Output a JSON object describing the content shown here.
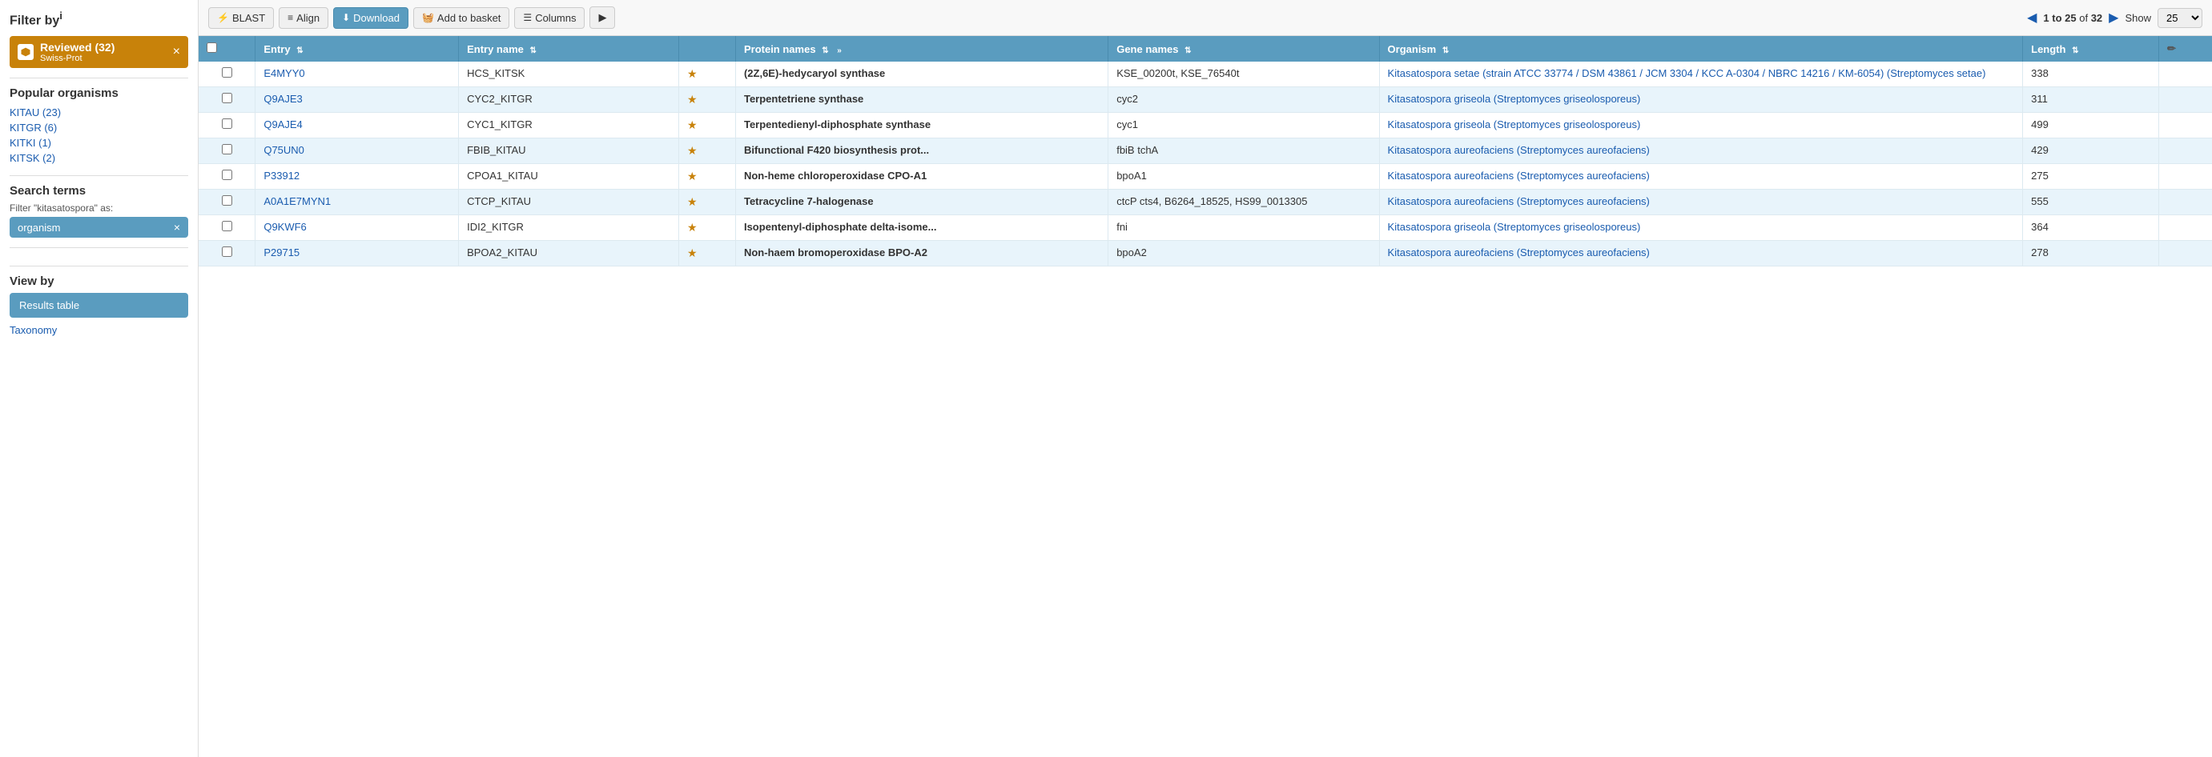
{
  "sidebar": {
    "filter_title": "Filter by",
    "filter_title_sup": "i",
    "reviewed_badge": {
      "label": "Reviewed (32)",
      "sublabel": "Swiss-Prot",
      "close": "×"
    },
    "popular_organisms_title": "Popular organisms",
    "organisms": [
      {
        "label": "KITAU (23)"
      },
      {
        "label": "KITGR (6)"
      },
      {
        "label": "KITKI (1)"
      },
      {
        "label": "KITSK (2)"
      }
    ],
    "search_terms_title": "Search terms",
    "filter_as_label": "Filter \"kitasatospora\" as:",
    "filter_tag": {
      "text": "organism",
      "close": "×"
    },
    "view_by_title": "View by",
    "results_table_btn": "Results table",
    "taxonomy_link": "Taxonomy"
  },
  "toolbar": {
    "blast_btn": "BLAST",
    "align_btn": "Align",
    "download_btn": "Download",
    "basket_btn": "Add to basket",
    "columns_btn": "Columns",
    "forward_btn": "▶",
    "pagination": {
      "prefix": "",
      "range": "1 to 25",
      "of": "of",
      "total": "32",
      "show_label": "Show",
      "show_value": "25"
    },
    "prev_icon": "◀",
    "next_icon": "▶"
  },
  "table": {
    "columns": [
      {
        "key": "checkbox",
        "label": ""
      },
      {
        "key": "entry",
        "label": "Entry"
      },
      {
        "key": "entry_name",
        "label": "Entry name"
      },
      {
        "key": "icon",
        "label": ""
      },
      {
        "key": "protein_names",
        "label": "Protein names"
      },
      {
        "key": "gene_names",
        "label": "Gene names"
      },
      {
        "key": "organism",
        "label": "Organism"
      },
      {
        "key": "length",
        "label": "Length"
      },
      {
        "key": "edit",
        "label": ""
      }
    ],
    "rows": [
      {
        "entry": "E4MYY0",
        "entry_name": "HCS_KITSK",
        "protein_names": "(2Z,6E)-hedycaryol synthase",
        "gene_names": "KSE_00200t, KSE_76540t",
        "organism": "Kitasatospora setae (strain ATCC 33774 / DSM 43861 / JCM 3304 / KCC A-0304 / NBRC 14216 / KM-6054) (Streptomyces setae)",
        "length": "338"
      },
      {
        "entry": "Q9AJE3",
        "entry_name": "CYC2_KITGR",
        "protein_names": "Terpentetriene synthase",
        "gene_names": "cyc2",
        "organism": "Kitasatospora griseola (Streptomyces griseolosporeus)",
        "length": "311"
      },
      {
        "entry": "Q9AJE4",
        "entry_name": "CYC1_KITGR",
        "protein_names": "Terpentedienyl-diphosphate synthase",
        "gene_names": "cyc1",
        "organism": "Kitasatospora griseola (Streptomyces griseolosporeus)",
        "length": "499"
      },
      {
        "entry": "Q75UN0",
        "entry_name": "FBIB_KITAU",
        "protein_names": "Bifunctional F420 biosynthesis prot...",
        "gene_names": "fbiB tchA",
        "organism": "Kitasatospora aureofaciens (Streptomyces aureofaciens)",
        "length": "429"
      },
      {
        "entry": "P33912",
        "entry_name": "CPOA1_KITAU",
        "protein_names": "Non-heme chloroperoxidase CPO-A1",
        "gene_names": "bpoA1",
        "organism": "Kitasatospora aureofaciens (Streptomyces aureofaciens)",
        "length": "275"
      },
      {
        "entry": "A0A1E7MYN1",
        "entry_name": "CTCP_KITAU",
        "protein_names": "Tetracycline 7-halogenase",
        "gene_names": "ctcP cts4, B6264_18525, HS99_0013305",
        "organism": "Kitasatospora aureofaciens (Streptomyces aureofaciens)",
        "length": "555"
      },
      {
        "entry": "Q9KWF6",
        "entry_name": "IDI2_KITGR",
        "protein_names": "Isopentenyl-diphosphate delta-isome...",
        "gene_names": "fni",
        "organism": "Kitasatospora griseola (Streptomyces griseolosporeus)",
        "length": "364"
      },
      {
        "entry": "P29715",
        "entry_name": "BPOA2_KITAU",
        "protein_names": "Non-haem bromoperoxidase BPO-A2",
        "gene_names": "bpoA2",
        "organism": "Kitasatospora aureofaciens (Streptomyces aureofaciens)",
        "length": "278"
      }
    ]
  },
  "icons": {
    "blast": "⚡",
    "align": "≡",
    "download": "⬇",
    "basket": "🧺",
    "columns": "☰",
    "star": "★",
    "pencil": "✏",
    "checkbox": "□",
    "sort": "⇅",
    "expand": "»"
  }
}
